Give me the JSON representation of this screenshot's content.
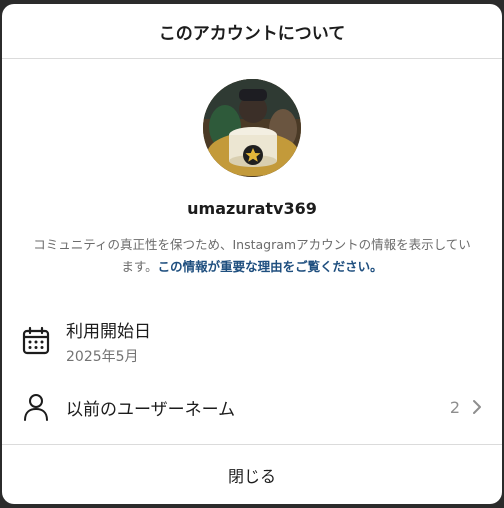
{
  "header": {
    "title": "このアカウントについて"
  },
  "profile": {
    "username": "umazuratv369",
    "description": "コミュニティの真正性を保つため、Instagramアカウントの情報を表示しています。",
    "link_text": "この情報が重要な理由をご覧ください。"
  },
  "rows": {
    "joined": {
      "label": "利用開始日",
      "value": "2025年5月",
      "icon": "calendar-icon"
    },
    "former_usernames": {
      "label": "以前のユーザーネーム",
      "count": "2",
      "icon": "person-icon"
    }
  },
  "footer": {
    "close_label": "閉じる"
  },
  "colors": {
    "link": "#1f4f7f",
    "divider": "#dbdbdb",
    "backdrop": "#2b2b2b"
  }
}
